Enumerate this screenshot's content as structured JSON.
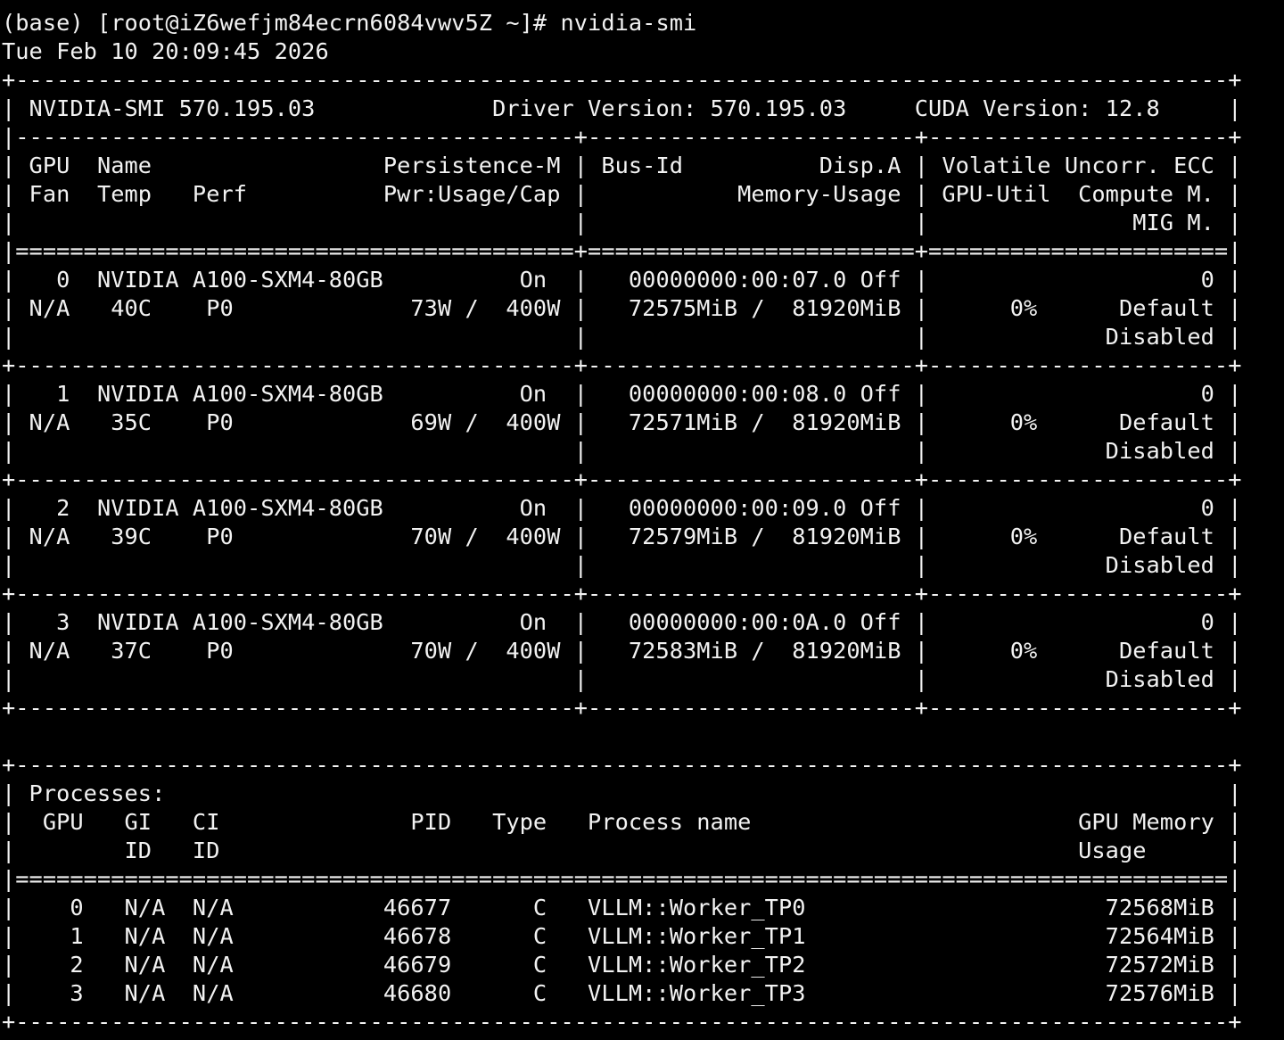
{
  "terminal": {
    "lines": [
      "(base) [root@iZ6wefjm84ecrn6084vwv5Z ~]# nvidia-smi",
      "Tue Feb 10 20:09:45 2026",
      "+-----------------------------------------------------------------------------------------+",
      "| NVIDIA-SMI 570.195.03             Driver Version: 570.195.03     CUDA Version: 12.8     |",
      "|-----------------------------------------+------------------------+----------------------+",
      "| GPU  Name                 Persistence-M | Bus-Id          Disp.A | Volatile Uncorr. ECC |",
      "| Fan  Temp   Perf          Pwr:Usage/Cap |           Memory-Usage | GPU-Util  Compute M. |",
      "|                                         |                        |               MIG M. |",
      "|=========================================+========================+======================|",
      "|   0  NVIDIA A100-SXM4-80GB          On  |   00000000:00:07.0 Off |                    0 |",
      "| N/A   40C    P0             73W /  400W |   72575MiB /  81920MiB |      0%      Default |",
      "|                                         |                        |             Disabled |",
      "+-----------------------------------------+------------------------+----------------------+",
      "|   1  NVIDIA A100-SXM4-80GB          On  |   00000000:00:08.0 Off |                    0 |",
      "| N/A   35C    P0             69W /  400W |   72571MiB /  81920MiB |      0%      Default |",
      "|                                         |                        |             Disabled |",
      "+-----------------------------------------+------------------------+----------------------+",
      "|   2  NVIDIA A100-SXM4-80GB          On  |   00000000:00:09.0 Off |                    0 |",
      "| N/A   39C    P0             70W /  400W |   72579MiB /  81920MiB |      0%      Default |",
      "|                                         |                        |             Disabled |",
      "+-----------------------------------------+------------------------+----------------------+",
      "|   3  NVIDIA A100-SXM4-80GB          On  |   00000000:00:0A.0 Off |                    0 |",
      "| N/A   37C    P0             70W /  400W |   72583MiB /  81920MiB |      0%      Default |",
      "|                                         |                        |             Disabled |",
      "+-----------------------------------------+------------------------+----------------------+",
      "",
      "+-----------------------------------------------------------------------------------------+",
      "| Processes:                                                                              |",
      "|  GPU   GI   CI              PID   Type   Process name                        GPU Memory |",
      "|        ID   ID                                                               Usage      |",
      "|=========================================================================================|",
      "|    0   N/A  N/A           46677      C   VLLM::Worker_TP0                      72568MiB |",
      "|    1   N/A  N/A           46678      C   VLLM::Worker_TP1                      72564MiB |",
      "|    2   N/A  N/A           46679      C   VLLM::Worker_TP2                      72572MiB |",
      "|    3   N/A  N/A           46680      C   VLLM::Worker_TP3                      72576MiB |",
      "+-----------------------------------------------------------------------------------------+"
    ]
  }
}
